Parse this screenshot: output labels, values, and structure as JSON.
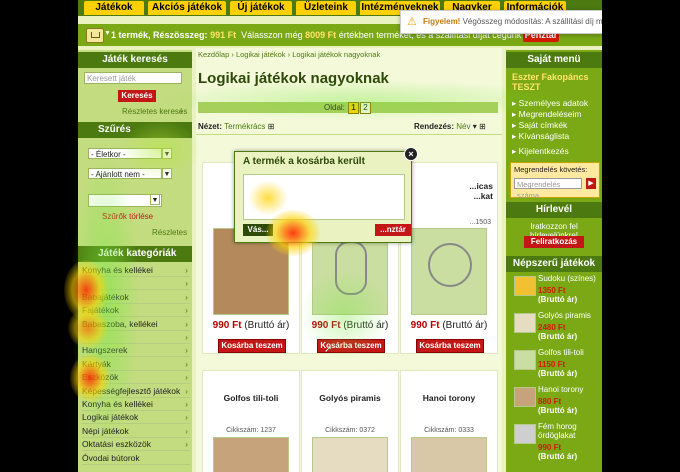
{
  "nav": {
    "tabs": [
      "Játékok",
      "Akciós játékok",
      "Új játékok",
      "Üzleteink",
      "Intézményeknek",
      "Nagyker",
      "Információk"
    ]
  },
  "notice": {
    "title": "Figyelem!",
    "text": "Végösszeg módosítás: A szállítási díj megváltozott!"
  },
  "cart": {
    "summary_prefix": "1 termék, Részösszeg:",
    "subtotal": "991 Ft",
    "hint_prefix": "Válasszon még",
    "hint_amount": "8009 Ft",
    "hint_suffix": "értékben terméket, és a szállítási díjat cégünk állja!",
    "checkout_label": "Pénztár"
  },
  "left": {
    "search_title": "Játék keresés",
    "search_placeholder": "Keresett játék",
    "search_button": "Keresés",
    "advanced_search": "Részletes keresés",
    "filter_title": "Szűrés",
    "filter_age": "- Életkor -",
    "filter_gender": "- Ajánlott nem -",
    "filter_clear": "Szűrők törlése",
    "filter_details": "Részletes",
    "categories_title": "Játék kategóriák",
    "categories": [
      {
        "label": "Konyha és kellékei",
        "arrow": true
      },
      {
        "label": "",
        "arrow": true
      },
      {
        "label": "Babajátékok",
        "arrow": true
      },
      {
        "label": "Fajátékok",
        "arrow": true
      },
      {
        "label": "Babaszoba, kellékei",
        "arrow": true
      },
      {
        "label": "",
        "arrow": true
      },
      {
        "label": "Hangszerek",
        "arrow": true
      },
      {
        "label": "Kártyák",
        "arrow": true
      },
      {
        "label": "Eszközök",
        "arrow": true
      },
      {
        "label": "Képességfejlesztő játékok",
        "arrow": true
      },
      {
        "label": "Konyha és kellékei",
        "arrow": true
      },
      {
        "label": "Logikai játékok",
        "arrow": true
      },
      {
        "label": "Népi játékok",
        "arrow": true
      },
      {
        "label": "Oktatási eszközök",
        "arrow": true
      },
      {
        "label": "Óvodai bútorok",
        "arrow": false
      }
    ]
  },
  "main": {
    "breadcrumb": "Kezdőlap › Logikai játékok › Logikai játékok nagyoknak",
    "title": "Logikai játékok nagyoknak",
    "pages_label": "Oldal:",
    "page1": "1",
    "page2": "2",
    "view_label": "Nézet:",
    "view_value": "Termékrács",
    "sort_label": "Rendezés:",
    "sort_value": "Név",
    "products_top": [
      {
        "name": "4 db ...",
        "code": "Cikkszám:",
        "price": "990 Ft",
        "price_note": "(Bruttó ár)",
        "button": "Kosárba teszem"
      },
      {
        "name": "",
        "code": "",
        "price": "990 Ft",
        "price_note": "(Bruttó ár)",
        "button": "Kosárba teszem"
      },
      {
        "name": "...icas ...kat",
        "code": "...1503",
        "price": "990 Ft",
        "price_note": "(Bruttó ár)",
        "button": "Kosárba teszem"
      }
    ],
    "products_bottom": [
      {
        "name": "Golfos tili-toli",
        "code": "Cikkszám: 1237"
      },
      {
        "name": "Golyós piramis",
        "code": "Cikkszám: 0372"
      },
      {
        "name": "Hanoi torony",
        "code": "Cikkszám: 0333"
      }
    ]
  },
  "popup": {
    "title": "A termék a kosárba került",
    "left_button": "Vás...",
    "right_button": "...nztár"
  },
  "right": {
    "menu_title": "Saját menü",
    "user_name": "Eszter Fakopáncs TESZT",
    "links": [
      "Személyes adatok",
      "Megrendeléseim",
      "Saját címkék",
      "Kívánságlista",
      "Kijelentkezés"
    ],
    "track_label": "Megrendelés követés:",
    "track_placeholder": "Megrendelés száma",
    "newsletter_title": "Hírlevél",
    "newsletter_text": "Iratkozzon fel hírlevelünkre!",
    "newsletter_button": "Feliratkozás",
    "popular_title": "Népszerű játékok",
    "popular": [
      {
        "name": "Sudoku (színes)",
        "price": "1350 Ft",
        "note": "(Bruttó ár)"
      },
      {
        "name": "Golyós piramis",
        "price": "2480 Ft",
        "note": "(Bruttó ár)"
      },
      {
        "name": "Golfos tili-toli",
        "price": "1150 Ft",
        "note": "(Bruttó ár)"
      },
      {
        "name": "Hanoi torony",
        "price": "880 Ft",
        "note": "(Bruttó ár)"
      },
      {
        "name": "Fém horog ördöglakat",
        "price": "990 Ft",
        "note": "(Bruttó ár)"
      }
    ]
  }
}
